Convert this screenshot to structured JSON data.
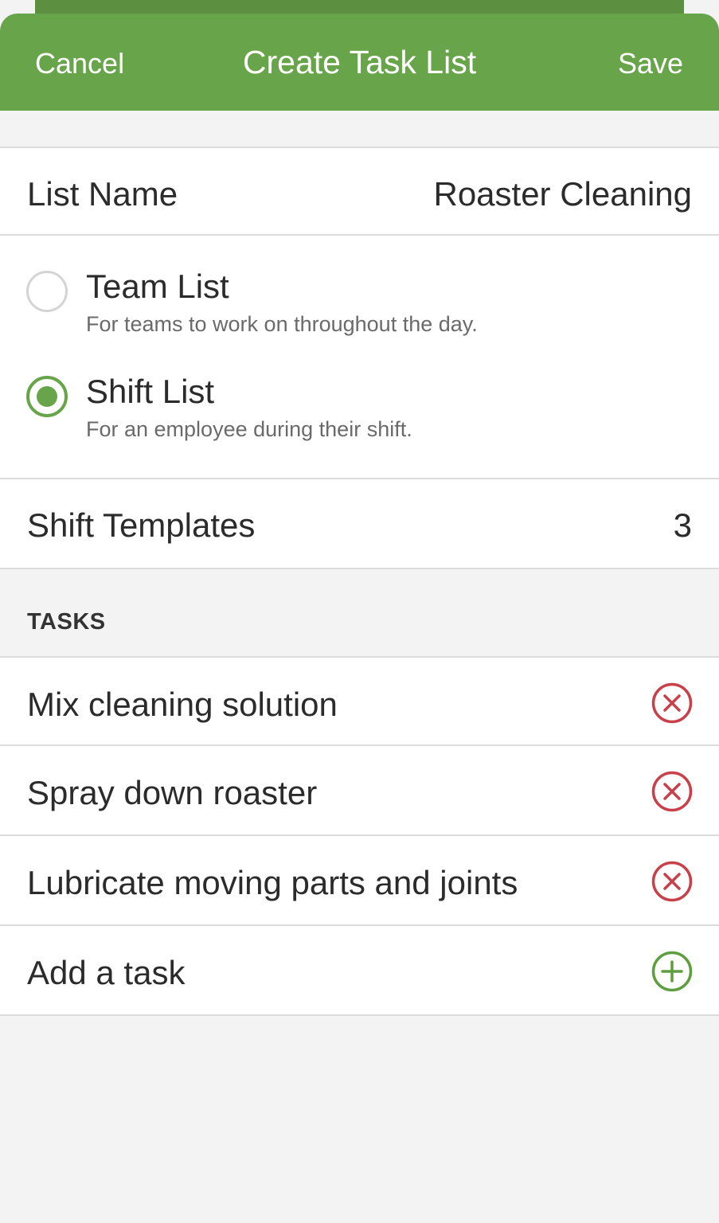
{
  "header": {
    "cancel_label": "Cancel",
    "title": "Create Task List",
    "save_label": "Save"
  },
  "list_name": {
    "label": "List Name",
    "value": "Roaster Cleaning"
  },
  "list_type": {
    "selected": "shift",
    "options": [
      {
        "id": "team",
        "title": "Team List",
        "description": "For teams to work on throughout the day.",
        "checked": false
      },
      {
        "id": "shift",
        "title": "Shift List",
        "description": "For an employee during their shift.",
        "checked": true
      }
    ]
  },
  "shift_templates": {
    "label": "Shift Templates",
    "count": "3"
  },
  "tasks": {
    "section_title": "TASKS",
    "items": [
      {
        "label": "Mix cleaning solution",
        "icon": "remove-circle-icon"
      },
      {
        "label": "Spray down roaster",
        "icon": "remove-circle-icon"
      },
      {
        "label": "Lubricate moving parts and joints",
        "icon": "remove-circle-icon"
      }
    ],
    "add_label": "Add a task",
    "add_icon": "add-circle-icon"
  },
  "colors": {
    "brand_green": "#68a54a",
    "remove_red": "#c8404a",
    "background": "#f3f3f3"
  }
}
